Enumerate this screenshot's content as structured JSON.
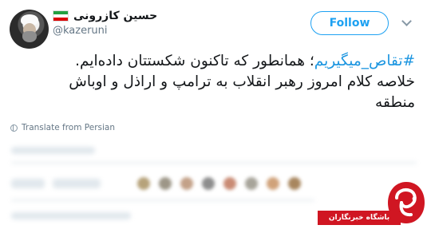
{
  "author": {
    "display_name": "حسین کازرونی",
    "handle": "@kazeruni",
    "flag": "iran-flag-icon"
  },
  "follow_label": "Follow",
  "tweet": {
    "hashtag": "#تقاص_میگیریم",
    "line1_rest": "؛ همانطور که تاکنون شکستتان داده‌ایم.",
    "line2": "خلاصه کلام امروز رهبر انقلاب به ترامپ و اراذل و اوباش",
    "line3": "منطقه"
  },
  "translate_label": "Translate from Persian",
  "watermark": {
    "text": "باشگاه خبرنگاران",
    "color": "#d01622"
  },
  "colors": {
    "accent": "#1da1f2",
    "hashtag": "#1b95e0",
    "muted": "#657786"
  }
}
